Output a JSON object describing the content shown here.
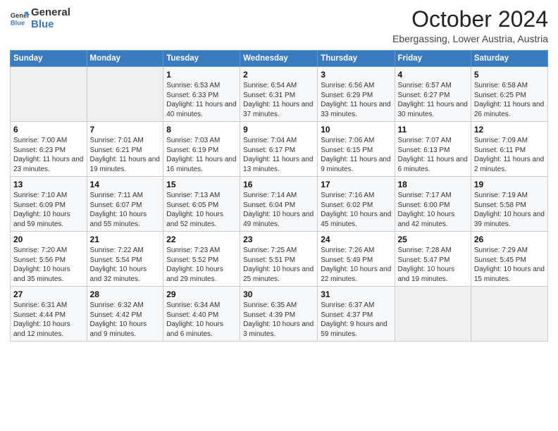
{
  "header": {
    "logo_line1": "General",
    "logo_line2": "Blue",
    "month": "October 2024",
    "location": "Ebergassing, Lower Austria, Austria"
  },
  "weekdays": [
    "Sunday",
    "Monday",
    "Tuesday",
    "Wednesday",
    "Thursday",
    "Friday",
    "Saturday"
  ],
  "weeks": [
    [
      {
        "day": "",
        "sunrise": "",
        "sunset": "",
        "daylight": ""
      },
      {
        "day": "",
        "sunrise": "",
        "sunset": "",
        "daylight": ""
      },
      {
        "day": "1",
        "sunrise": "Sunrise: 6:53 AM",
        "sunset": "Sunset: 6:33 PM",
        "daylight": "Daylight: 11 hours and 40 minutes."
      },
      {
        "day": "2",
        "sunrise": "Sunrise: 6:54 AM",
        "sunset": "Sunset: 6:31 PM",
        "daylight": "Daylight: 11 hours and 37 minutes."
      },
      {
        "day": "3",
        "sunrise": "Sunrise: 6:56 AM",
        "sunset": "Sunset: 6:29 PM",
        "daylight": "Daylight: 11 hours and 33 minutes."
      },
      {
        "day": "4",
        "sunrise": "Sunrise: 6:57 AM",
        "sunset": "Sunset: 6:27 PM",
        "daylight": "Daylight: 11 hours and 30 minutes."
      },
      {
        "day": "5",
        "sunrise": "Sunrise: 6:58 AM",
        "sunset": "Sunset: 6:25 PM",
        "daylight": "Daylight: 11 hours and 26 minutes."
      }
    ],
    [
      {
        "day": "6",
        "sunrise": "Sunrise: 7:00 AM",
        "sunset": "Sunset: 6:23 PM",
        "daylight": "Daylight: 11 hours and 23 minutes."
      },
      {
        "day": "7",
        "sunrise": "Sunrise: 7:01 AM",
        "sunset": "Sunset: 6:21 PM",
        "daylight": "Daylight: 11 hours and 19 minutes."
      },
      {
        "day": "8",
        "sunrise": "Sunrise: 7:03 AM",
        "sunset": "Sunset: 6:19 PM",
        "daylight": "Daylight: 11 hours and 16 minutes."
      },
      {
        "day": "9",
        "sunrise": "Sunrise: 7:04 AM",
        "sunset": "Sunset: 6:17 PM",
        "daylight": "Daylight: 11 hours and 13 minutes."
      },
      {
        "day": "10",
        "sunrise": "Sunrise: 7:06 AM",
        "sunset": "Sunset: 6:15 PM",
        "daylight": "Daylight: 11 hours and 9 minutes."
      },
      {
        "day": "11",
        "sunrise": "Sunrise: 7:07 AM",
        "sunset": "Sunset: 6:13 PM",
        "daylight": "Daylight: 11 hours and 6 minutes."
      },
      {
        "day": "12",
        "sunrise": "Sunrise: 7:09 AM",
        "sunset": "Sunset: 6:11 PM",
        "daylight": "Daylight: 11 hours and 2 minutes."
      }
    ],
    [
      {
        "day": "13",
        "sunrise": "Sunrise: 7:10 AM",
        "sunset": "Sunset: 6:09 PM",
        "daylight": "Daylight: 10 hours and 59 minutes."
      },
      {
        "day": "14",
        "sunrise": "Sunrise: 7:11 AM",
        "sunset": "Sunset: 6:07 PM",
        "daylight": "Daylight: 10 hours and 55 minutes."
      },
      {
        "day": "15",
        "sunrise": "Sunrise: 7:13 AM",
        "sunset": "Sunset: 6:05 PM",
        "daylight": "Daylight: 10 hours and 52 minutes."
      },
      {
        "day": "16",
        "sunrise": "Sunrise: 7:14 AM",
        "sunset": "Sunset: 6:04 PM",
        "daylight": "Daylight: 10 hours and 49 minutes."
      },
      {
        "day": "17",
        "sunrise": "Sunrise: 7:16 AM",
        "sunset": "Sunset: 6:02 PM",
        "daylight": "Daylight: 10 hours and 45 minutes."
      },
      {
        "day": "18",
        "sunrise": "Sunrise: 7:17 AM",
        "sunset": "Sunset: 6:00 PM",
        "daylight": "Daylight: 10 hours and 42 minutes."
      },
      {
        "day": "19",
        "sunrise": "Sunrise: 7:19 AM",
        "sunset": "Sunset: 5:58 PM",
        "daylight": "Daylight: 10 hours and 39 minutes."
      }
    ],
    [
      {
        "day": "20",
        "sunrise": "Sunrise: 7:20 AM",
        "sunset": "Sunset: 5:56 PM",
        "daylight": "Daylight: 10 hours and 35 minutes."
      },
      {
        "day": "21",
        "sunrise": "Sunrise: 7:22 AM",
        "sunset": "Sunset: 5:54 PM",
        "daylight": "Daylight: 10 hours and 32 minutes."
      },
      {
        "day": "22",
        "sunrise": "Sunrise: 7:23 AM",
        "sunset": "Sunset: 5:52 PM",
        "daylight": "Daylight: 10 hours and 29 minutes."
      },
      {
        "day": "23",
        "sunrise": "Sunrise: 7:25 AM",
        "sunset": "Sunset: 5:51 PM",
        "daylight": "Daylight: 10 hours and 25 minutes."
      },
      {
        "day": "24",
        "sunrise": "Sunrise: 7:26 AM",
        "sunset": "Sunset: 5:49 PM",
        "daylight": "Daylight: 10 hours and 22 minutes."
      },
      {
        "day": "25",
        "sunrise": "Sunrise: 7:28 AM",
        "sunset": "Sunset: 5:47 PM",
        "daylight": "Daylight: 10 hours and 19 minutes."
      },
      {
        "day": "26",
        "sunrise": "Sunrise: 7:29 AM",
        "sunset": "Sunset: 5:45 PM",
        "daylight": "Daylight: 10 hours and 15 minutes."
      }
    ],
    [
      {
        "day": "27",
        "sunrise": "Sunrise: 6:31 AM",
        "sunset": "Sunset: 4:44 PM",
        "daylight": "Daylight: 10 hours and 12 minutes."
      },
      {
        "day": "28",
        "sunrise": "Sunrise: 6:32 AM",
        "sunset": "Sunset: 4:42 PM",
        "daylight": "Daylight: 10 hours and 9 minutes."
      },
      {
        "day": "29",
        "sunrise": "Sunrise: 6:34 AM",
        "sunset": "Sunset: 4:40 PM",
        "daylight": "Daylight: 10 hours and 6 minutes."
      },
      {
        "day": "30",
        "sunrise": "Sunrise: 6:35 AM",
        "sunset": "Sunset: 4:39 PM",
        "daylight": "Daylight: 10 hours and 3 minutes."
      },
      {
        "day": "31",
        "sunrise": "Sunrise: 6:37 AM",
        "sunset": "Sunset: 4:37 PM",
        "daylight": "Daylight: 9 hours and 59 minutes."
      },
      {
        "day": "",
        "sunrise": "",
        "sunset": "",
        "daylight": ""
      },
      {
        "day": "",
        "sunrise": "",
        "sunset": "",
        "daylight": ""
      }
    ]
  ]
}
